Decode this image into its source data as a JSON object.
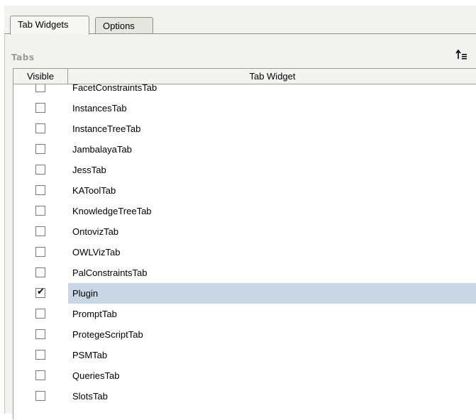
{
  "tabs": [
    {
      "label": "Tab Widgets",
      "active": true
    },
    {
      "label": "Options",
      "active": false
    }
  ],
  "section": {
    "title": "Tabs",
    "sort_icon": "sort-ascending-icon"
  },
  "table": {
    "headers": {
      "visible": "Visible",
      "widget": "Tab Widget"
    },
    "rows": [
      {
        "name": "FacetConstraintsTab",
        "checked": false,
        "selected": false
      },
      {
        "name": "InstancesTab",
        "checked": false,
        "selected": false
      },
      {
        "name": "InstanceTreeTab",
        "checked": false,
        "selected": false
      },
      {
        "name": "JambalayaTab",
        "checked": false,
        "selected": false
      },
      {
        "name": "JessTab",
        "checked": false,
        "selected": false
      },
      {
        "name": "KAToolTab",
        "checked": false,
        "selected": false
      },
      {
        "name": "KnowledgeTreeTab",
        "checked": false,
        "selected": false
      },
      {
        "name": "OntovizTab",
        "checked": false,
        "selected": false
      },
      {
        "name": "OWLVizTab",
        "checked": false,
        "selected": false
      },
      {
        "name": "PalConstraintsTab",
        "checked": false,
        "selected": false
      },
      {
        "name": "Plugin",
        "checked": true,
        "selected": true
      },
      {
        "name": "PromptTab",
        "checked": false,
        "selected": false
      },
      {
        "name": "ProtegeScriptTab",
        "checked": false,
        "selected": false
      },
      {
        "name": "PSMTab",
        "checked": false,
        "selected": false
      },
      {
        "name": "QueriesTab",
        "checked": false,
        "selected": false
      },
      {
        "name": "SlotsTab",
        "checked": false,
        "selected": false
      }
    ]
  },
  "colors": {
    "selection": "#c8d6e5",
    "section_title": "#9a9a9a",
    "background": "#f2f2ee"
  }
}
